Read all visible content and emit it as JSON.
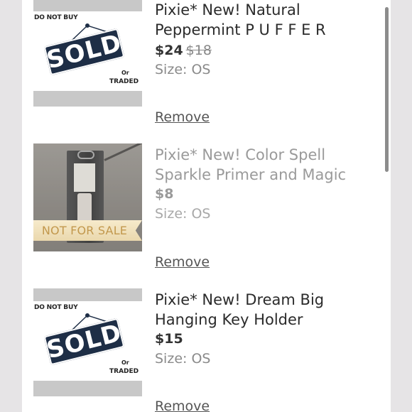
{
  "items": [
    {
      "thumb_type": "sold",
      "thumb_text": {
        "top": "DO NOT BUY",
        "sign": "SOLD",
        "or": "Or",
        "traded": "TRADED"
      },
      "title_line1": "Pixie* New! Natural",
      "title_line2": "Peppermint P U F F E R",
      "price": "$24",
      "original_price": "$18",
      "size": "Size: OS",
      "remove": "Remove"
    },
    {
      "thumb_type": "photo",
      "thumb_text": {
        "ribbon": "NOT FOR SALE"
      },
      "title_line1": "Pixie* New! Color Spell",
      "title_line2": "Sparkle Primer and Magic",
      "price": "$8",
      "size": "Size: OS",
      "remove": "Remove"
    },
    {
      "thumb_type": "sold",
      "thumb_text": {
        "top": "DO NOT BUY",
        "sign": "SOLD",
        "or": "Or",
        "traded": "TRADED"
      },
      "title_line1": "Pixie* New! Dream Big",
      "title_line2": "Hanging Key Holder",
      "price": "$15",
      "size": "Size: OS",
      "remove": "Remove"
    }
  ],
  "colors": {
    "sign_navy": "#1e2e46",
    "ribbon_gold": "#b8872e",
    "text_dark": "#2b2b2b",
    "text_grey": "#9a9a9a"
  }
}
